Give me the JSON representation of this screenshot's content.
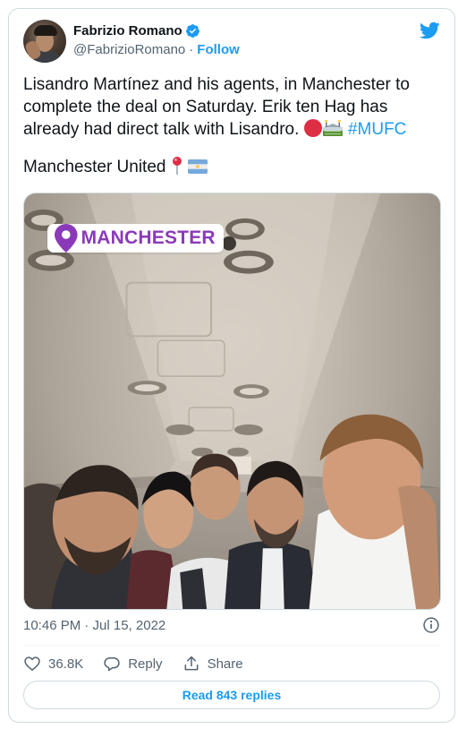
{
  "author": {
    "display_name": "Fabrizio Romano",
    "handle": "@FabrizioRomano",
    "separator": "·",
    "follow_label": "Follow",
    "verified": true
  },
  "tweet": {
    "line1": "Lisandro Martínez and his agents, in Manchester to",
    "line2": "complete the deal on Saturday. Erik ten Hag has",
    "line3_text": "already had direct talk with Lisandro.",
    "hashtag": "#MUFC",
    "line4_text": "Manchester United",
    "emojis": [
      "red-circle",
      "stadium",
      "round-pushpin",
      "argentina-flag"
    ]
  },
  "media": {
    "location_sticker": "MANCHESTER"
  },
  "meta": {
    "timestamp": "10:46 PM · Jul 15, 2022"
  },
  "actions": {
    "like_count": "36.8K",
    "reply_label": "Reply",
    "share_label": "Share"
  },
  "read_replies_label": "Read 843 replies",
  "colors": {
    "accent": "#1d9bf0",
    "text": "#0f1419",
    "secondary": "#536471",
    "border": "#cfd9de",
    "sticker_purple": "#8a3ab9"
  }
}
